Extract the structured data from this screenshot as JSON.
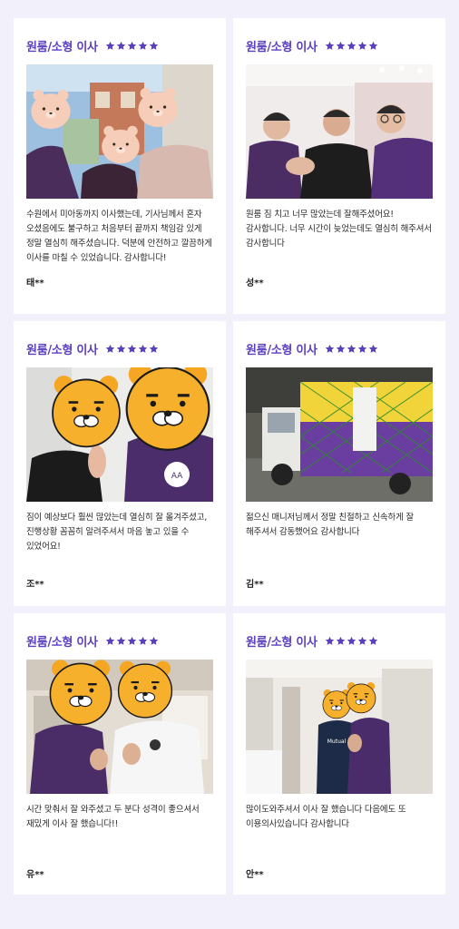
{
  "reviews": [
    {
      "title": "원룸/소형 이사",
      "rating": 5,
      "text": "수원에서 미아동까지 이사했는데, 기사님께서 혼자 오셨음에도 불구하고 처음부터 끝까지 책임감 있게 정말 열심히 해주셨습니다. 덕분에 안전하고 깔끔하게 이사를 마칠 수 있었습니다. 감사합니다!",
      "author": "태**"
    },
    {
      "title": "원룸/소형 이사",
      "rating": 5,
      "text": "원룸 짐 치고 너무 많았는데 잘해주셨어요! 감사합니다. 너무 시간이 늦었는데도 열심히 해주셔서 감사합니다",
      "author": "성**"
    },
    {
      "title": "원룸/소형 이사",
      "rating": 5,
      "text": "짐이 예상보다 훨씬 많았는데 열심히 잘 옮겨주셨고, 진행상황 꼼꼼히 알려주셔서 마음 놓고 있을 수 있었어요!",
      "author": "조**"
    },
    {
      "title": "원룸/소형 이사",
      "rating": 5,
      "text": "젊으신 매니저님께서 정말 친절하고 신속하게 잘 해주셔서 감동했어요 감사합니다",
      "author": "김**"
    },
    {
      "title": "원룸/소형 이사",
      "rating": 5,
      "text": "시간 맞춰서 잘 와주셨고 두 분다 성격이 좋으셔서 재밌게 이사 잘 했습니다!!",
      "author": "유**"
    },
    {
      "title": "원룸/소형 이사",
      "rating": 5,
      "text": "많이도와주셔서 이사 잘 했습니다 다음에도 또 이용의사있습니다 감사합니다",
      "author": "안**"
    }
  ],
  "colors": {
    "accent": "#5a3fc0",
    "background": "#f1f0fb",
    "card": "#ffffff"
  },
  "icons": {
    "star": "star-icon"
  }
}
